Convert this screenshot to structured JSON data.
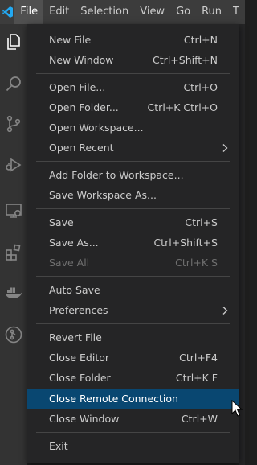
{
  "colors": {
    "menubar_bg": "#3c3c3c",
    "menu_bg": "#252526",
    "highlight_bg": "#094771",
    "activitybar_bg": "#333333",
    "vscode_blue": "#23a9f2",
    "disabled_text": "#6f6f6f"
  },
  "menubar": {
    "items": [
      {
        "label": "File"
      },
      {
        "label": "Edit"
      },
      {
        "label": "Selection"
      },
      {
        "label": "View"
      },
      {
        "label": "Go"
      },
      {
        "label": "Run"
      },
      {
        "label": "T"
      }
    ]
  },
  "activitybar": {
    "icons": [
      "explorer-icon",
      "search-icon",
      "source-control-icon",
      "run-debug-icon",
      "remote-explorer-icon",
      "extensions-icon",
      "docker-icon",
      "git-graph-icon"
    ]
  },
  "file_menu": {
    "items": [
      {
        "label": "New File",
        "shortcut": "Ctrl+N"
      },
      {
        "label": "New Window",
        "shortcut": "Ctrl+Shift+N"
      },
      {
        "label": "Open File...",
        "shortcut": "Ctrl+O"
      },
      {
        "label": "Open Folder...",
        "shortcut": "Ctrl+K Ctrl+O"
      },
      {
        "label": "Open Workspace...",
        "shortcut": ""
      },
      {
        "label": "Open Recent",
        "shortcut": "",
        "submenu": true
      },
      {
        "label": "Add Folder to Workspace...",
        "shortcut": ""
      },
      {
        "label": "Save Workspace As...",
        "shortcut": ""
      },
      {
        "label": "Save",
        "shortcut": "Ctrl+S"
      },
      {
        "label": "Save As...",
        "shortcut": "Ctrl+Shift+S"
      },
      {
        "label": "Save All",
        "shortcut": "Ctrl+K S",
        "disabled": true
      },
      {
        "label": "Auto Save",
        "shortcut": ""
      },
      {
        "label": "Preferences",
        "shortcut": "",
        "submenu": true
      },
      {
        "label": "Revert File",
        "shortcut": ""
      },
      {
        "label": "Close Editor",
        "shortcut": "Ctrl+F4"
      },
      {
        "label": "Close Folder",
        "shortcut": "Ctrl+K F"
      },
      {
        "label": "Close Remote Connection",
        "shortcut": "",
        "highlighted": true
      },
      {
        "label": "Close Window",
        "shortcut": "Ctrl+W"
      },
      {
        "label": "Exit",
        "shortcut": ""
      }
    ]
  }
}
